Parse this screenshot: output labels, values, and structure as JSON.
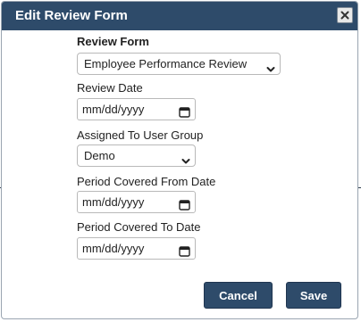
{
  "dialog": {
    "title": "Edit Review Form",
    "close_icon": "close-x-icon"
  },
  "form": {
    "review_form": {
      "label": "Review Form",
      "value": "Employee Performance Review"
    },
    "review_date": {
      "label": "Review Date",
      "value": "mm/dd/yyyy"
    },
    "assigned_group": {
      "label": "Assigned To User Group",
      "value": "Demo"
    },
    "period_from": {
      "label": "Period Covered From Date",
      "value": "mm/dd/yyyy"
    },
    "period_to": {
      "label": "Period Covered To Date",
      "value": "mm/dd/yyyy"
    }
  },
  "buttons": {
    "cancel": "Cancel",
    "save": "Save"
  },
  "colors": {
    "header": "#2e4b6a",
    "button": "#2e4b6a"
  }
}
